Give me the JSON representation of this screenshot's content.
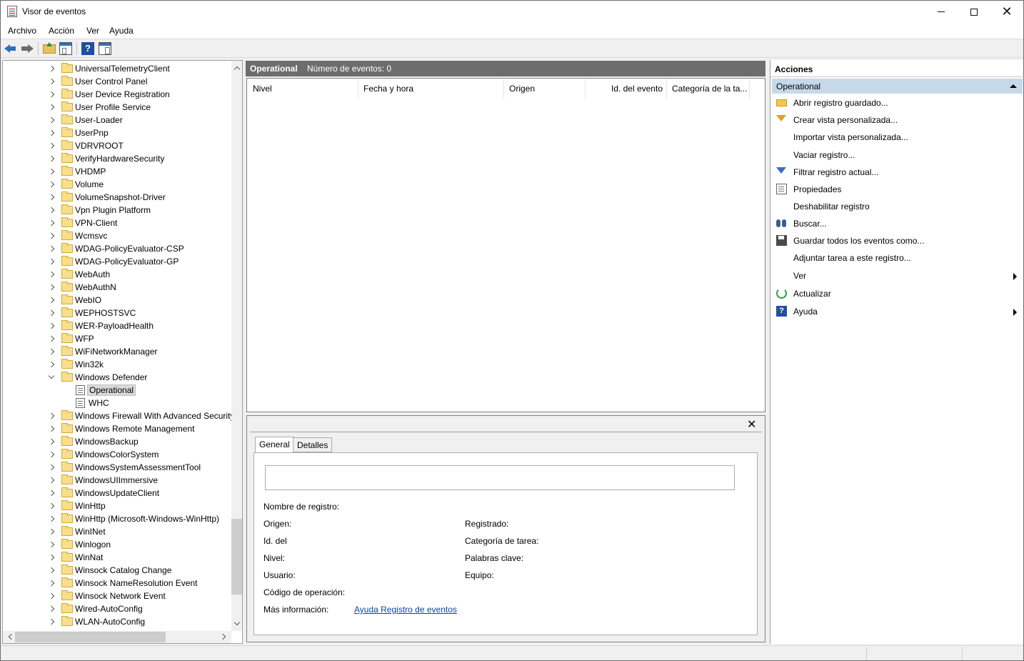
{
  "window": {
    "title": "Visor de eventos"
  },
  "menu": [
    "Archivo",
    "Acción",
    "Ver",
    "Ayuda"
  ],
  "tree": {
    "items": [
      {
        "label": "UniversalTelemetryClient",
        "type": "folder",
        "expanded": false
      },
      {
        "label": "User Control Panel",
        "type": "folder",
        "expanded": false
      },
      {
        "label": "User Device Registration",
        "type": "folder",
        "expanded": false
      },
      {
        "label": "User Profile Service",
        "type": "folder",
        "expanded": false
      },
      {
        "label": "User-Loader",
        "type": "folder",
        "expanded": false
      },
      {
        "label": "UserPnp",
        "type": "folder",
        "expanded": false
      },
      {
        "label": "VDRVROOT",
        "type": "folder",
        "expanded": false
      },
      {
        "label": "VerifyHardwareSecurity",
        "type": "folder",
        "expanded": false
      },
      {
        "label": "VHDMP",
        "type": "folder",
        "expanded": false
      },
      {
        "label": "Volume",
        "type": "folder",
        "expanded": false
      },
      {
        "label": "VolumeSnapshot-Driver",
        "type": "folder",
        "expanded": false
      },
      {
        "label": "Vpn Plugin Platform",
        "type": "folder",
        "expanded": false
      },
      {
        "label": "VPN-Client",
        "type": "folder",
        "expanded": false
      },
      {
        "label": "Wcmsvc",
        "type": "folder",
        "expanded": false
      },
      {
        "label": "WDAG-PolicyEvaluator-CSP",
        "type": "folder",
        "expanded": false
      },
      {
        "label": "WDAG-PolicyEvaluator-GP",
        "type": "folder",
        "expanded": false
      },
      {
        "label": "WebAuth",
        "type": "folder",
        "expanded": false
      },
      {
        "label": "WebAuthN",
        "type": "folder",
        "expanded": false
      },
      {
        "label": "WebIO",
        "type": "folder",
        "expanded": false
      },
      {
        "label": "WEPHOSTSVC",
        "type": "folder",
        "expanded": false
      },
      {
        "label": "WER-PayloadHealth",
        "type": "folder",
        "expanded": false
      },
      {
        "label": "WFP",
        "type": "folder",
        "expanded": false
      },
      {
        "label": "WiFiNetworkManager",
        "type": "folder",
        "expanded": false
      },
      {
        "label": "Win32k",
        "type": "folder",
        "expanded": false
      },
      {
        "label": "Windows Defender",
        "type": "folder",
        "expanded": true
      },
      {
        "label": "Operational",
        "type": "log",
        "selected": true
      },
      {
        "label": "WHC",
        "type": "log"
      },
      {
        "label": "Windows Firewall With Advanced Security",
        "type": "folder",
        "expanded": false
      },
      {
        "label": "Windows Remote Management",
        "type": "folder",
        "expanded": false
      },
      {
        "label": "WindowsBackup",
        "type": "folder",
        "expanded": false
      },
      {
        "label": "WindowsColorSystem",
        "type": "folder",
        "expanded": false
      },
      {
        "label": "WindowsSystemAssessmentTool",
        "type": "folder",
        "expanded": false
      },
      {
        "label": "WindowsUIImmersive",
        "type": "folder",
        "expanded": false
      },
      {
        "label": "WindowsUpdateClient",
        "type": "folder",
        "expanded": false
      },
      {
        "label": "WinHttp",
        "type": "folder",
        "expanded": false
      },
      {
        "label": "WinHttp (Microsoft-Windows-WinHttp)",
        "type": "folder",
        "expanded": false
      },
      {
        "label": "WinINet",
        "type": "folder",
        "expanded": false
      },
      {
        "label": "Winlogon",
        "type": "folder",
        "expanded": false
      },
      {
        "label": "WinNat",
        "type": "folder",
        "expanded": false
      },
      {
        "label": "Winsock Catalog Change",
        "type": "folder",
        "expanded": false
      },
      {
        "label": "Winsock NameResolution Event",
        "type": "folder",
        "expanded": false
      },
      {
        "label": "Winsock Network Event",
        "type": "folder",
        "expanded": false
      },
      {
        "label": "Wired-AutoConfig",
        "type": "folder",
        "expanded": false
      },
      {
        "label": "WLAN-AutoConfig",
        "type": "folder",
        "expanded": false
      }
    ]
  },
  "center": {
    "title": "Operational",
    "count_text": "Número de eventos: 0",
    "columns": [
      "Nivel",
      "Fecha y hora",
      "Origen",
      "Id. del evento",
      "Categoría de la ta..."
    ]
  },
  "details": {
    "tabs": [
      "General",
      "Detalles"
    ],
    "active_tab": "General",
    "fields_left": [
      "Nombre de registro:",
      "Origen:",
      "Id. del",
      "Nivel:",
      "Usuario:",
      "Código de operación:",
      "Más información:"
    ],
    "fields_right": [
      "Registrado:",
      "Categoría de tarea:",
      "Palabras clave:",
      "Equipo:"
    ],
    "more_info_link": "Ayuda Registro de eventos"
  },
  "actions": {
    "header": "Acciones",
    "section": "Operational",
    "items": [
      {
        "label": "Abrir registro guardado...",
        "icon": "open-folder-icon"
      },
      {
        "label": "Crear vista personalizada...",
        "icon": "filter-create-icon"
      },
      {
        "label": "Importar vista personalizada...",
        "icon": ""
      },
      {
        "label": "Vaciar registro...",
        "icon": ""
      },
      {
        "label": "Filtrar registro actual...",
        "icon": "filter-icon"
      },
      {
        "label": "Propiedades",
        "icon": "properties-icon"
      },
      {
        "label": "Deshabilitar registro",
        "icon": ""
      },
      {
        "label": "Buscar...",
        "icon": "binoculars-icon"
      },
      {
        "label": "Guardar todos los eventos como...",
        "icon": "save-icon"
      },
      {
        "label": "Adjuntar tarea a este registro...",
        "icon": ""
      },
      {
        "label": "Ver",
        "icon": "",
        "submenu": true
      },
      {
        "label": "Actualizar",
        "icon": "refresh-icon"
      },
      {
        "label": "Ayuda",
        "icon": "help-icon",
        "submenu": true
      }
    ]
  },
  "colors": {
    "header_gray": "#6d6d6d",
    "section_blue": "#c7d8ea",
    "link_blue": "#0645ad",
    "folder_yellow": "#f9df8b"
  }
}
